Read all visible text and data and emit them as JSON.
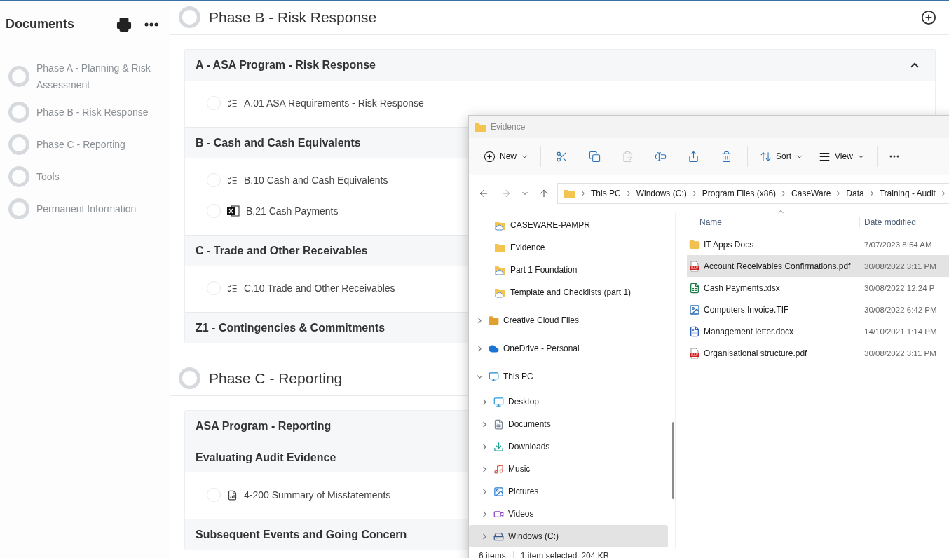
{
  "sidebar": {
    "title": "Documents",
    "items": [
      {
        "label": "Phase A - Planning & Risk Assessment"
      },
      {
        "label": "Phase B - Risk Response"
      },
      {
        "label": "Phase C - Reporting"
      },
      {
        "label": "Tools"
      },
      {
        "label": "Permanent Information"
      }
    ]
  },
  "phases": [
    {
      "title": "Phase B - Risk Response",
      "sections": [
        {
          "title": "A - ASA Program - Risk Response",
          "expanded": true,
          "items": [
            {
              "kind": "checklist",
              "label": "A.01 ASA Requirements - Risk Response"
            }
          ]
        },
        {
          "title": "B - Cash and Cash Equivalents",
          "items": [
            {
              "kind": "checklist",
              "label": "B.10 Cash and Cash Equivalents"
            },
            {
              "kind": "excel",
              "label": "B.21 Cash Payments"
            }
          ]
        },
        {
          "title": "C - Trade and Other Receivables",
          "items": [
            {
              "kind": "checklist",
              "label": "C.10 Trade and Other Receivables"
            }
          ]
        },
        {
          "title": "Z1 - Contingencies & Commitments"
        }
      ]
    },
    {
      "title": "Phase C - Reporting",
      "sections": [
        {
          "title": "ASA Program - Reporting"
        },
        {
          "title": "Evaluating Audit Evidence",
          "items": [
            {
              "kind": "report",
              "label": "4-200 Summary of Misstatements"
            }
          ]
        },
        {
          "title": "Subsequent Events and Going Concern"
        }
      ]
    }
  ],
  "explorer": {
    "title": "Evidence",
    "toolbar": {
      "new_label": "New",
      "actions": [
        {
          "kind": "cut",
          "disabled": false
        },
        {
          "kind": "copy",
          "disabled": false
        },
        {
          "kind": "paste",
          "disabled": true
        },
        {
          "kind": "rename",
          "disabled": false
        },
        {
          "kind": "share",
          "disabled": false
        },
        {
          "kind": "delete",
          "disabled": false
        }
      ],
      "sort_label": "Sort",
      "view_label": "View"
    },
    "breadcrumb": [
      "This PC",
      "Windows (C:)",
      "Program Files (x86)",
      "CaseWare",
      "Data",
      "Training - Audit"
    ],
    "nav": {
      "pinned": [
        {
          "kind": "cloud-folder",
          "label": "CASEWARE-PAMPR"
        },
        {
          "kind": "folder",
          "label": "Evidence"
        },
        {
          "kind": "cloud-folder",
          "label": "Part 1 Foundation"
        },
        {
          "kind": "cloud-folder",
          "label": "Template and Checklists (part 1)"
        }
      ],
      "roots": [
        {
          "kind": "cc-folder",
          "label": "Creative Cloud Files",
          "expanded": false,
          "selected": false
        },
        {
          "kind": "onedrive",
          "label": "OneDrive - Personal",
          "expanded": false,
          "selected": false
        },
        {
          "kind": "pc",
          "label": "This PC",
          "expanded": true,
          "selected": false,
          "children": [
            {
              "kind": "desktop",
              "label": "Desktop",
              "expanded": false,
              "selected": false
            },
            {
              "kind": "documents",
              "label": "Documents",
              "expanded": false,
              "selected": false
            },
            {
              "kind": "downloads",
              "label": "Downloads",
              "expanded": false,
              "selected": false
            },
            {
              "kind": "music",
              "label": "Music",
              "expanded": false,
              "selected": false
            },
            {
              "kind": "pictures",
              "label": "Pictures",
              "expanded": false,
              "selected": false
            },
            {
              "kind": "videos",
              "label": "Videos",
              "expanded": false,
              "selected": false
            },
            {
              "kind": "drive",
              "label": "Windows (C:)",
              "expanded": false,
              "selected": true
            }
          ]
        }
      ]
    },
    "columns": [
      "Name",
      "Date modified"
    ],
    "files": [
      {
        "kind": "folder",
        "name": "IT Apps Docs",
        "date": "7/07/2023 8:54 AM",
        "selected": false
      },
      {
        "kind": "pdf",
        "name": "Account Receivables Confirmations.pdf",
        "date": "30/08/2022 3:11 PM",
        "selected": true
      },
      {
        "kind": "excel",
        "name": "Cash Payments.xlsx",
        "date": "30/08/2022 12:24 P",
        "selected": false
      },
      {
        "kind": "image",
        "name": "Computers Invoice.TIF",
        "date": "30/08/2022 6:42 PM",
        "selected": false
      },
      {
        "kind": "word",
        "name": "Management letter.docx",
        "date": "14/10/2021 1:14 PM",
        "selected": false
      },
      {
        "kind": "pdf",
        "name": "Organisational structure.pdf",
        "date": "30/08/2022 3:11 PM",
        "selected": false
      }
    ],
    "status": {
      "count": "6 items",
      "selection": "1 item selected",
      "size": "204 KB"
    }
  }
}
